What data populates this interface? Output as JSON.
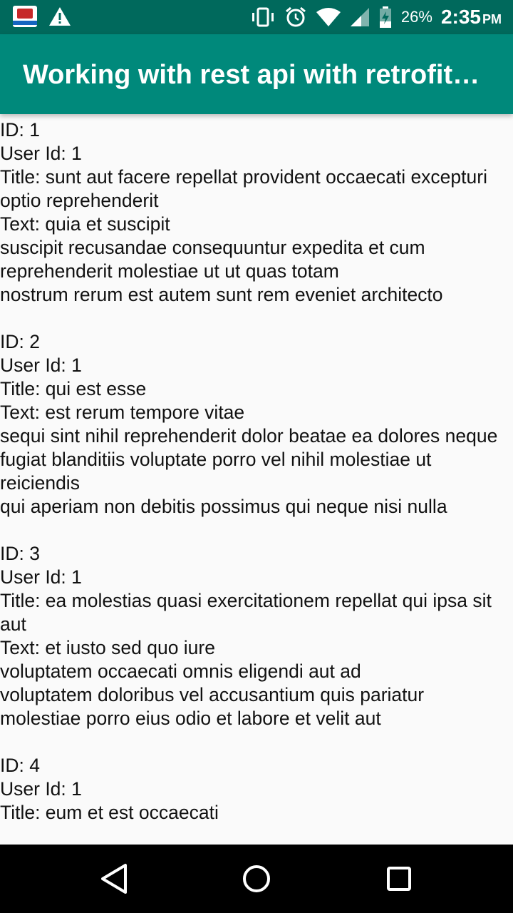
{
  "status_bar": {
    "left_icons": [
      "app-notification-icon",
      "warning-icon"
    ],
    "right_icons": [
      "vibrate-icon",
      "alarm-icon",
      "wifi-icon",
      "cell-signal-icon",
      "battery-charging-icon"
    ],
    "battery_percent": "26%",
    "time": "2:35",
    "ampm": "PM"
  },
  "app_bar": {
    "title": "Working with rest api with retrofit…"
  },
  "posts": [
    {
      "id_line": "ID: 1",
      "user_line": "User Id: 1",
      "title_line": "Title: sunt aut facere repellat provident occaecati excepturi optio reprehenderit",
      "text_lines": [
        "Text: quia et suscipit",
        "suscipit recusandae consequuntur expedita et cum reprehenderit molestiae ut ut quas totam",
        "nostrum rerum est autem sunt rem eveniet architecto"
      ]
    },
    {
      "id_line": "ID: 2",
      "user_line": "User Id: 1",
      "title_line": "Title: qui est esse",
      "text_lines": [
        "Text: est rerum tempore vitae",
        "sequi sint nihil reprehenderit dolor beatae ea dolores neque",
        "fugiat blanditiis voluptate porro vel nihil molestiae ut reiciendis",
        "qui aperiam non debitis possimus qui neque nisi nulla"
      ]
    },
    {
      "id_line": "ID: 3",
      "user_line": "User Id: 1",
      "title_line": "Title: ea molestias quasi exercitationem repellat qui ipsa sit aut",
      "text_lines": [
        "Text: et iusto sed quo iure",
        "voluptatem occaecati omnis eligendi aut ad",
        "voluptatem doloribus vel accusantium quis pariatur",
        "molestiae porro eius odio et labore et velit aut"
      ]
    },
    {
      "id_line": "ID: 4",
      "user_line": "User Id: 1",
      "title_line": "Title: eum et est occaecati",
      "text_lines": []
    }
  ],
  "nav_bar": {
    "buttons": [
      "back-icon",
      "home-icon",
      "recents-icon"
    ]
  }
}
